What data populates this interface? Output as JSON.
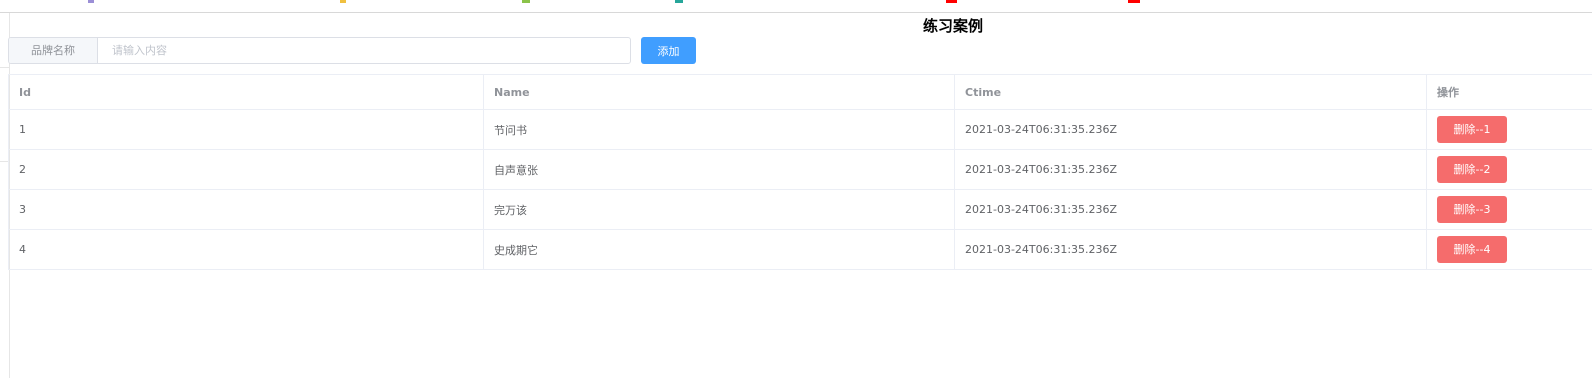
{
  "page": {
    "title": "练习案例"
  },
  "form": {
    "brand_label": "品牌名称",
    "brand_placeholder": "请输入内容",
    "brand_value": "",
    "add_label": "添加"
  },
  "table": {
    "columns": [
      "Id",
      "Name",
      "Ctime",
      "操作"
    ],
    "rows": [
      {
        "id": "1",
        "name": "节问书",
        "ctime": "2021-03-24T06:31:35.236Z",
        "action": "删除--1"
      },
      {
        "id": "2",
        "name": "自声意张",
        "ctime": "2021-03-24T06:31:35.236Z",
        "action": "删除--2"
      },
      {
        "id": "3",
        "name": "完万该",
        "ctime": "2021-03-24T06:31:35.236Z",
        "action": "删除--3"
      },
      {
        "id": "4",
        "name": "史成期它",
        "ctime": "2021-03-24T06:31:35.236Z",
        "action": "删除--4"
      }
    ]
  },
  "colors": {
    "primary": "#409eff",
    "danger": "#f56c6c",
    "border": "#ebeef5",
    "header_text": "#909399",
    "body_text": "#606266"
  }
}
